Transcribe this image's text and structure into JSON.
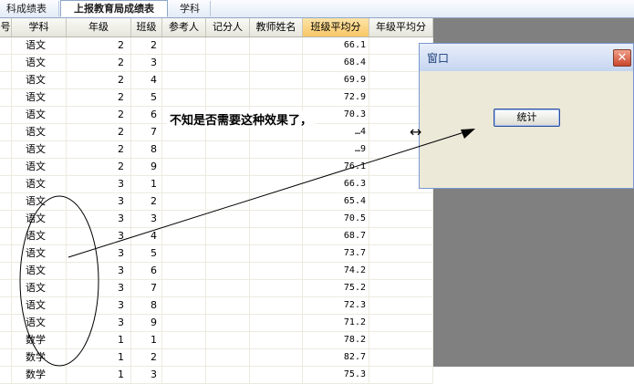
{
  "tabs": [
    {
      "label": "科成绩表",
      "active": false
    },
    {
      "label": "上报教育局成绩表",
      "active": true
    },
    {
      "label": "学科",
      "active": false
    }
  ],
  "grid": {
    "headers": [
      "号",
      "学科",
      "年级",
      "班级",
      "参考人",
      "记分人",
      "教师姓名",
      "班级平均分",
      "年级平均分"
    ],
    "selected_header": "班级平均分",
    "rows": [
      {
        "subject": "语文",
        "grade": "2",
        "class": "2",
        "avg": "66.1"
      },
      {
        "subject": "语文",
        "grade": "2",
        "class": "3",
        "avg": "68.4"
      },
      {
        "subject": "语文",
        "grade": "2",
        "class": "4",
        "avg": "69.9"
      },
      {
        "subject": "语文",
        "grade": "2",
        "class": "5",
        "avg": "72.9"
      },
      {
        "subject": "语文",
        "grade": "2",
        "class": "6",
        "avg": "70.3"
      },
      {
        "subject": "语文",
        "grade": "2",
        "class": "7",
        "avg": "…4"
      },
      {
        "subject": "语文",
        "grade": "2",
        "class": "8",
        "avg": "…9"
      },
      {
        "subject": "语文",
        "grade": "2",
        "class": "9",
        "avg": "76.1"
      },
      {
        "subject": "语文",
        "grade": "3",
        "class": "1",
        "avg": "66.3"
      },
      {
        "subject": "语文",
        "grade": "3",
        "class": "2",
        "avg": "65.4"
      },
      {
        "subject": "语文",
        "grade": "3",
        "class": "3",
        "avg": "70.5"
      },
      {
        "subject": "语文",
        "grade": "3",
        "class": "4",
        "avg": "68.7"
      },
      {
        "subject": "语文",
        "grade": "3",
        "class": "5",
        "avg": "73.7"
      },
      {
        "subject": "语文",
        "grade": "3",
        "class": "6",
        "avg": "74.2"
      },
      {
        "subject": "语文",
        "grade": "3",
        "class": "7",
        "avg": "75.2"
      },
      {
        "subject": "语文",
        "grade": "3",
        "class": "8",
        "avg": "72.3"
      },
      {
        "subject": "语文",
        "grade": "3",
        "class": "9",
        "avg": "71.2"
      },
      {
        "subject": "数学",
        "grade": "1",
        "class": "1",
        "avg": "78.2"
      },
      {
        "subject": "数学",
        "grade": "1",
        "class": "2",
        "avg": "82.7"
      },
      {
        "subject": "数学",
        "grade": "1",
        "class": "3",
        "avg": "75.3"
      }
    ]
  },
  "window": {
    "title": "窗口",
    "close_glyph": "✕",
    "button_label": "统计"
  },
  "annotation": {
    "text": "不知是否需要这种效果了，",
    "color": "#000000"
  },
  "colors": {
    "selected_header": "#f8c766",
    "gray_area": "#808080",
    "window_border": "#7a96d0"
  }
}
